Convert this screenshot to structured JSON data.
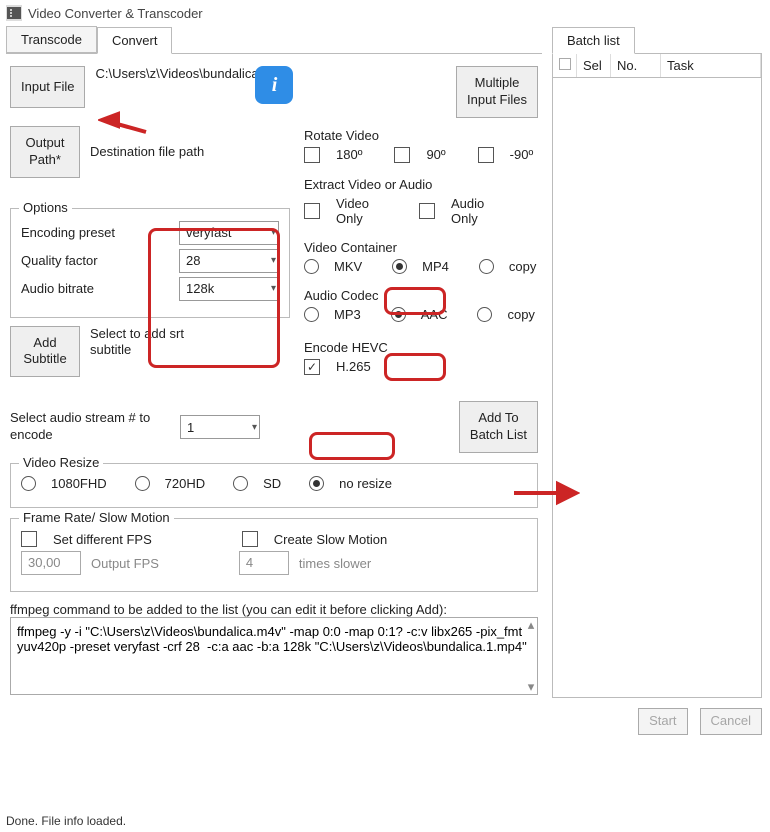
{
  "window": {
    "title": "Video Converter & Transcoder"
  },
  "tabs": {
    "transcode": "Transcode",
    "convert": "Convert",
    "batch": "Batch list"
  },
  "buttons": {
    "inputFile": "Input File",
    "multipleInput": "Multiple\nInput Files",
    "outputPath": "Output\nPath*",
    "addSubtitle": "Add\nSubtitle",
    "addToBatch": "Add To\nBatch List",
    "start": "Start",
    "cancel": "Cancel"
  },
  "labels": {
    "inputPath": "C:\\Users\\z\\Videos\\bundalica.m4v",
    "destPath": "Destination file path",
    "options": "Options",
    "encodingPreset": "Encoding preset",
    "qualityFactor": "Quality factor",
    "audioBitrate": "Audio bitrate",
    "selectSrt": "Select to add srt subtitle",
    "rotateVideo": "Rotate Video",
    "rot180": "180º",
    "rot90": "90º",
    "rotNeg90": "-90º",
    "extract": "Extract Video or Audio",
    "videoOnly": "Video\nOnly",
    "audioOnly": "Audio\nOnly",
    "videoContainer": "Video Container",
    "mkv": "MKV",
    "mp4": "MP4",
    "copy": "copy",
    "audioCodec": "Audio Codec",
    "mp3": "MP3",
    "aac": "AAC",
    "encodeHevc": "Encode HEVC",
    "h265": "H.265",
    "selectAudioStream": "Select audio stream # to encode",
    "videoResize": "Video Resize",
    "r1080": "1080FHD",
    "r720": "720HD",
    "rsd": "SD",
    "rnone": "no resize",
    "frameRate": "Frame Rate/ Slow Motion",
    "setFps": "Set different FPS",
    "createSlow": "Create Slow Motion",
    "outputFps": "Output FPS",
    "timesSlower": "times slower",
    "cmdHeader": "ffmpeg command to be added to the list (you can edit it before clicking Add):"
  },
  "values": {
    "preset": "veryfast",
    "quality": "28",
    "bitrate": "128k",
    "audioStream": "1",
    "fps": "30,00",
    "slowTimes": "4",
    "cmd": "ffmpeg -y -i \"C:\\Users\\z\\Videos\\bundalica.m4v\" -map 0:0 -map 0:1? -c:v libx265 -pix_fmt yuv420p -preset veryfast -crf 28  -c:a aac -b:a 128k \"C:\\Users\\z\\Videos\\bundalica.1.mp4\""
  },
  "batch": {
    "colBlank": "",
    "colSel": "Sel",
    "colNo": "No.",
    "colTask": "Task"
  },
  "status": "Done. File info loaded."
}
